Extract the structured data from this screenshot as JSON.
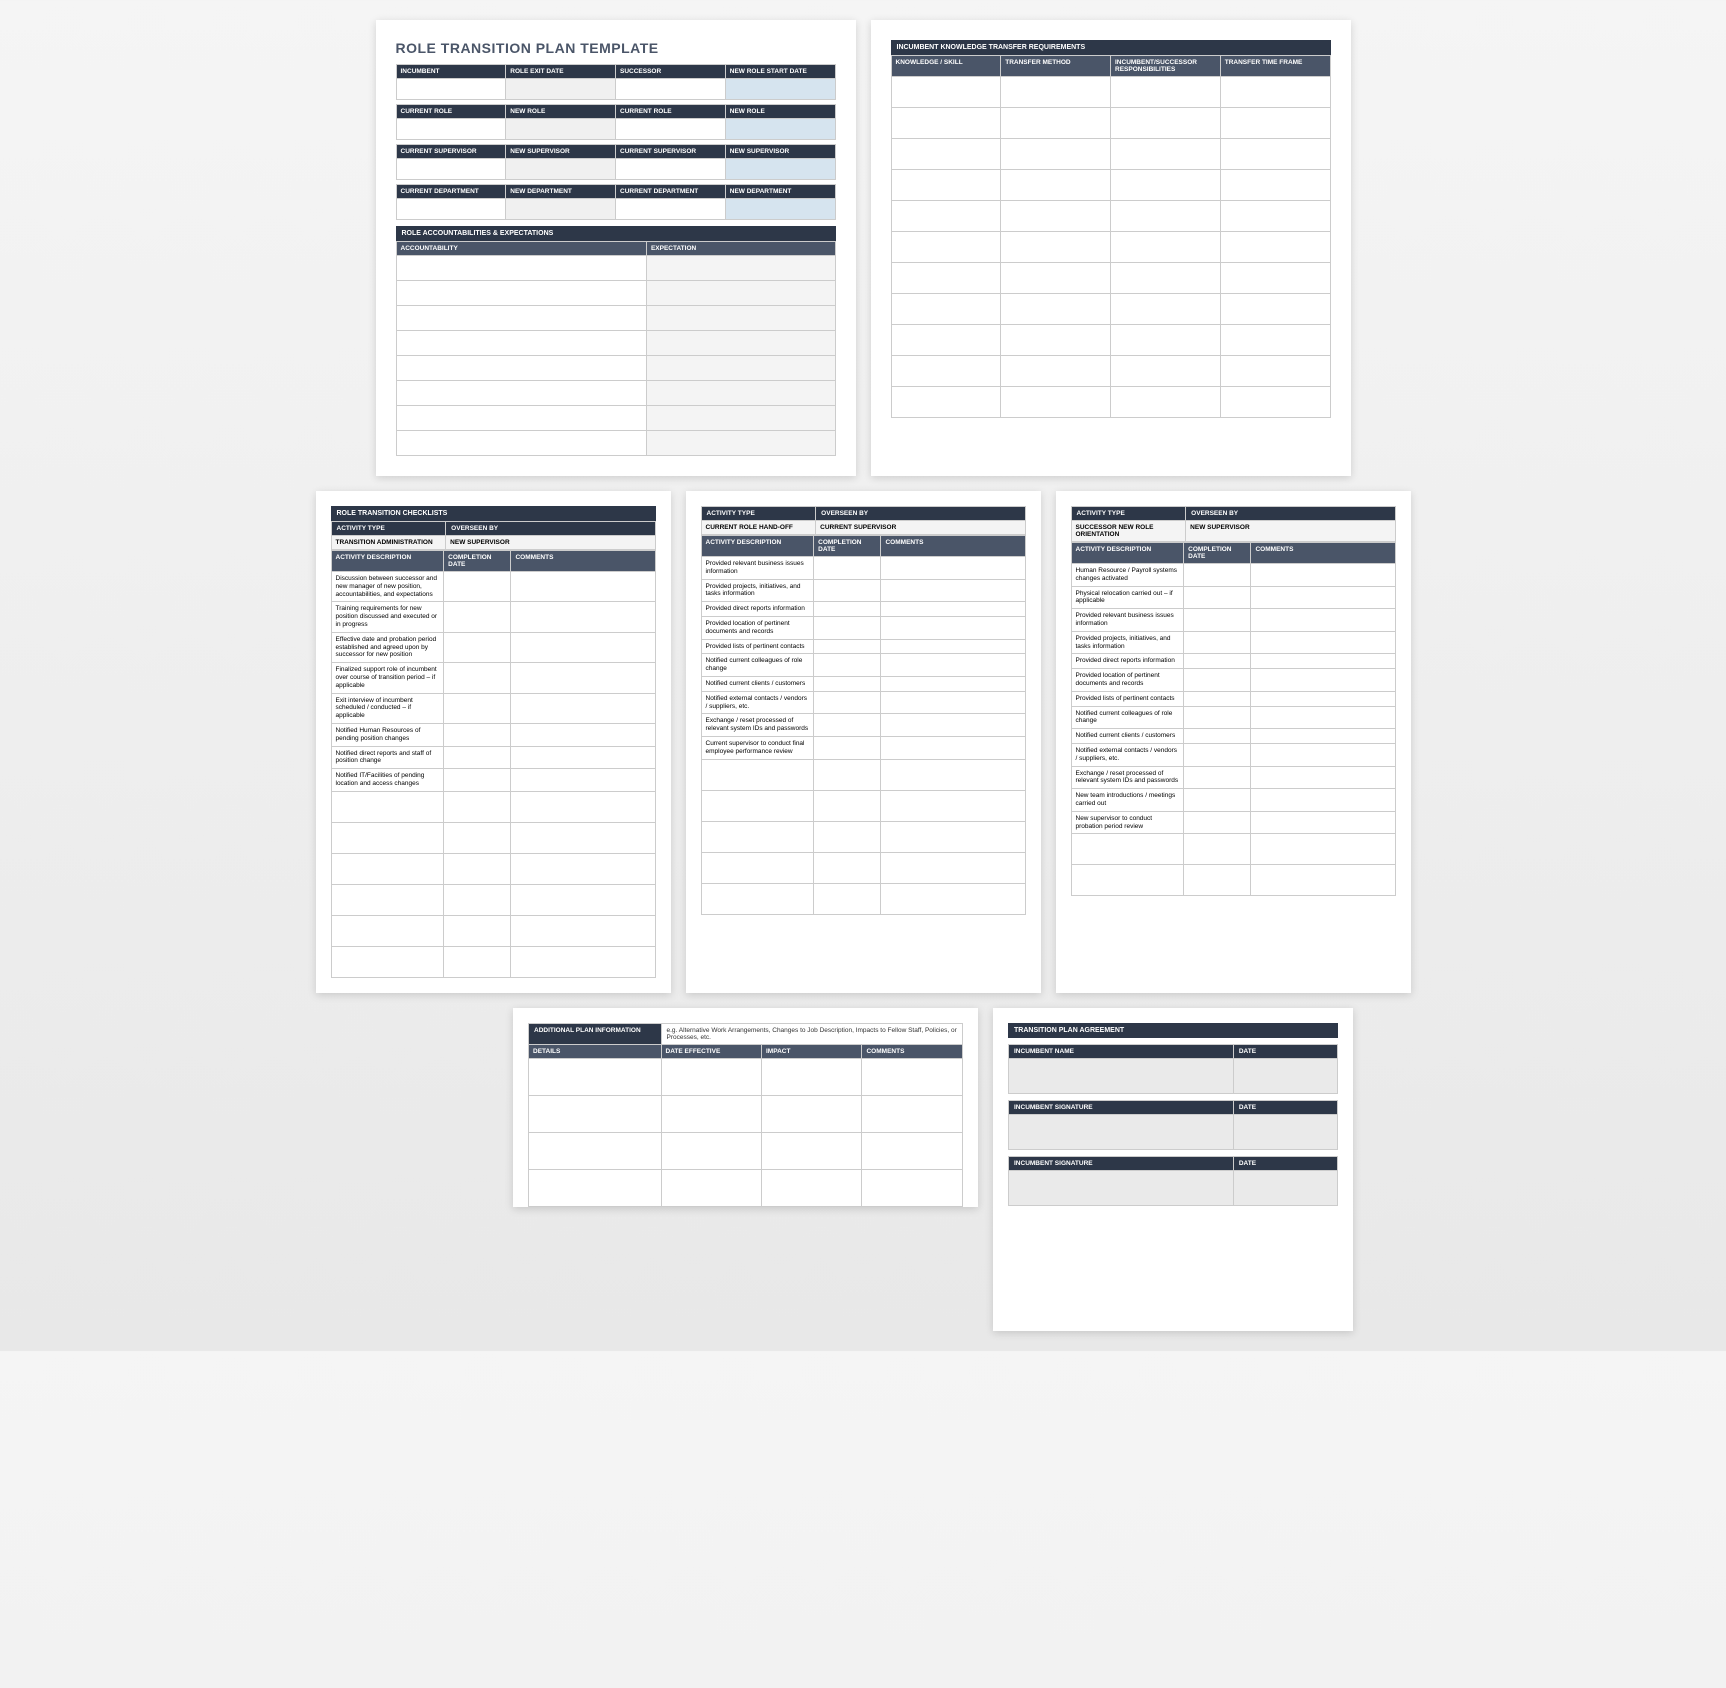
{
  "title": "ROLE TRANSITION PLAN TEMPLATE",
  "p1": {
    "grid": {
      "r1": [
        "INCUMBENT",
        "ROLE EXIT DATE",
        "SUCCESSOR",
        "NEW ROLE START DATE"
      ],
      "r2": [
        "CURRENT ROLE",
        "NEW ROLE",
        "CURRENT ROLE",
        "NEW ROLE"
      ],
      "r3": [
        "CURRENT SUPERVISOR",
        "NEW SUPERVISOR",
        "CURRENT SUPERVISOR",
        "NEW SUPERVISOR"
      ],
      "r4": [
        "CURRENT DEPARTMENT",
        "NEW DEPARTMENT",
        "CURRENT DEPARTMENT",
        "NEW DEPARTMENT"
      ]
    },
    "acc_title": "ROLE ACCOUNTABILITIES & EXPECTATIONS",
    "acc_cols": [
      "ACCOUNTABILITY",
      "EXPECTATION"
    ]
  },
  "p2": {
    "title": "INCUMBENT KNOWLEDGE TRANSFER REQUIREMENTS",
    "cols": [
      "KNOWLEDGE / SKILL",
      "TRANSFER METHOD",
      "INCUMBENT/SUCCESSOR RESPONSIBILITIES",
      "TRANSFER TIME FRAME"
    ]
  },
  "chk": {
    "title": "ROLE TRANSITION CHECKLISTS",
    "col_a": "ACTIVITY TYPE",
    "col_b": "OVERSEEN BY",
    "desc": "ACTIVITY DESCRIPTION",
    "cdate": "COMPLETION DATE",
    "comm": "COMMENTS"
  },
  "c1": {
    "type": "TRANSITION ADMINISTRATION",
    "by": "NEW SUPERVISOR",
    "rows": [
      "Discussion between successor and new manager of new position, accountabilities, and expectations",
      "Training requirements for new position discussed and executed or in progress",
      "Effective date and probation period established and agreed upon by successor for new position",
      "Finalized support role of incumbent over course of transition period – if applicable",
      "Exit interview of incumbent scheduled / conducted – if applicable",
      "Notified Human Resources of pending position changes",
      "Notified direct reports and staff of position change",
      "Notified IT/Facilities of pending location and access changes"
    ]
  },
  "c2": {
    "type": "CURRENT ROLE HAND-OFF",
    "by": "CURRENT SUPERVISOR",
    "rows": [
      "Provided relevant business issues information",
      "Provided projects, initiatives, and tasks information",
      "Provided direct reports information",
      "Provided location of pertinent documents and records",
      "Provided lists of pertinent contacts",
      "Notified current colleagues of role change",
      "Notified current clients / customers",
      "Notified external contacts / vendors / suppliers, etc.",
      "Exchange / reset processed of relevant system IDs and passwords",
      "Current supervisor to conduct final employee performance review"
    ]
  },
  "c3": {
    "type": "SUCCESSOR NEW ROLE ORIENTATION",
    "by": "NEW SUPERVISOR",
    "rows": [
      "Human Resource / Payroll systems changes activated",
      "Physical relocation carried out – if applicable",
      "Provided relevant business issues information",
      "Provided projects, initiatives, and tasks information",
      "Provided direct reports information",
      "Provided location of pertinent documents and records",
      "Provided lists of pertinent contacts",
      "Notified current colleagues of role change",
      "Notified current clients / customers",
      "Notified external contacts / vendors / suppliers, etc.",
      "Exchange / reset processed of relevant system IDs and passwords",
      "New team introductions / meetings carried out",
      "New supervisor to conduct probation period review"
    ]
  },
  "p6": {
    "title": "ADDITIONAL PLAN INFORMATION",
    "hint": "e.g. Alternative Work Arrangements, Changes to Job Description, Impacts to Fellow Staff, Policies, or Processes, etc.",
    "cols": [
      "DETAILS",
      "DATE EFFECTIVE",
      "IMPACT",
      "COMMENTS"
    ]
  },
  "p7": {
    "title": "TRANSITION PLAN AGREEMENT",
    "rows": [
      [
        "INCUMBENT NAME",
        "DATE"
      ],
      [
        "INCUMBENT SIGNATURE",
        "DATE"
      ],
      [
        "INCUMBENT SIGNATURE",
        "DATE"
      ]
    ]
  }
}
